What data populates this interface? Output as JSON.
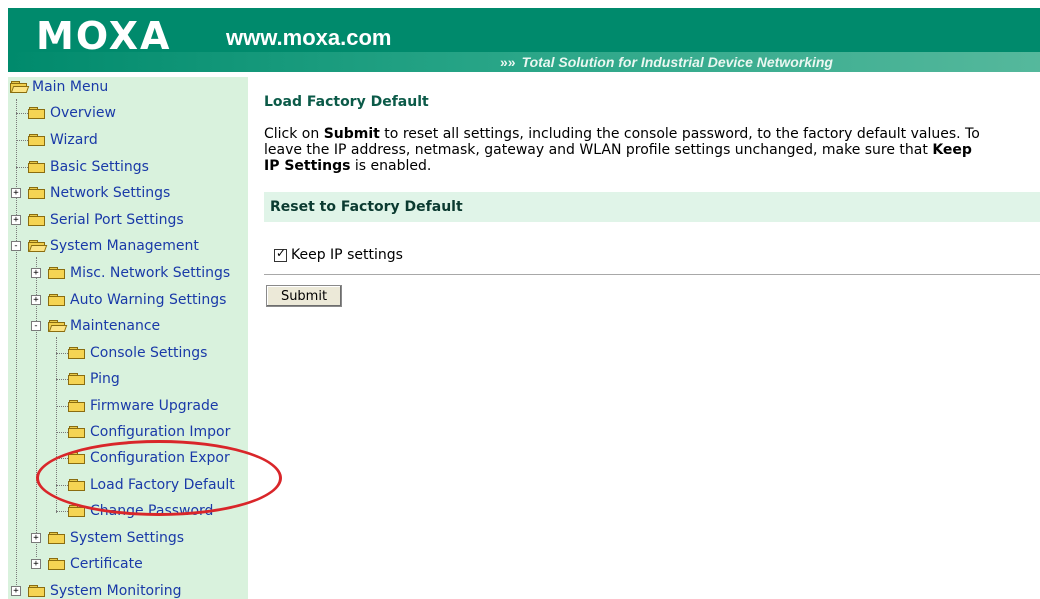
{
  "header": {
    "logo": "MOXA",
    "website": "www.moxa.com",
    "tagline": "Total Solution for Industrial Device Networking",
    "tagline_arrows": "»»",
    "brand_color": "#008a6c"
  },
  "sidebar": {
    "root": "Main Menu",
    "items": [
      {
        "label": "Overview"
      },
      {
        "label": "Wizard"
      },
      {
        "label": "Basic Settings"
      },
      {
        "label": "Network Settings",
        "expander": "+"
      },
      {
        "label": "Serial Port Settings",
        "expander": "+"
      },
      {
        "label": "System Management",
        "expander": "-"
      },
      {
        "label": "Misc. Network Settings",
        "expander": "+"
      },
      {
        "label": "Auto Warning Settings",
        "expander": "+"
      },
      {
        "label": "Maintenance",
        "expander": "-"
      },
      {
        "label": "Console Settings"
      },
      {
        "label": "Ping"
      },
      {
        "label": "Firmware Upgrade"
      },
      {
        "label": "Configuration Impor"
      },
      {
        "label": "Configuration Expor"
      },
      {
        "label": "Load Factory Default"
      },
      {
        "label": "Change Password"
      },
      {
        "label": "System Settings",
        "expander": "+"
      },
      {
        "label": "Certificate",
        "expander": "+"
      },
      {
        "label": "System Monitoring",
        "expander": "+"
      }
    ],
    "selected": "Load Factory Default"
  },
  "main": {
    "title": "Load Factory Default",
    "desc": {
      "line1_pre": "Click on ",
      "line1_bold": "Submit",
      "line1_post": " to reset all settings, including the console password, to the factory default values. To",
      "line2_pre": "leave the IP address, netmask, gateway and WLAN profile settings unchanged, make sure that ",
      "line2_bold": "Keep",
      "line3_bold": "IP Settings",
      "line3_post": " is enabled."
    },
    "section_title": "Reset to Factory Default",
    "keep_ip_label": "Keep IP settings",
    "keep_ip_checked": true,
    "submit_label": "Submit"
  },
  "colors": {
    "sidebar_bg": "#d9f2dd",
    "section_bg": "#e0f4e8",
    "highlight": "#d9262a",
    "link": "#1a3aa8"
  }
}
